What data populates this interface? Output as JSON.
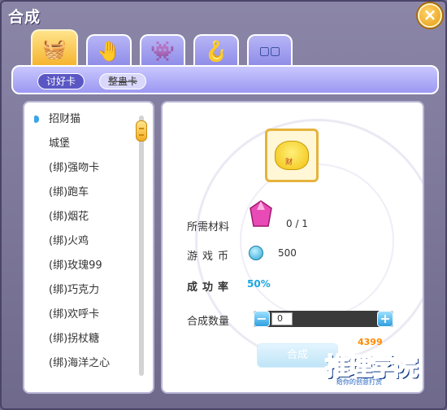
{
  "window": {
    "title": "合成",
    "close_label": "×"
  },
  "tabs": [
    {
      "name": "basket",
      "glyph": "🧺",
      "active": true
    },
    {
      "name": "hand",
      "glyph": "🤚",
      "active": false
    },
    {
      "name": "pet",
      "glyph": "👾",
      "active": false
    },
    {
      "name": "hanger",
      "glyph": "🪝",
      "active": false
    },
    {
      "name": "grid",
      "glyph": "▢▢",
      "active": false
    }
  ],
  "subtabs": {
    "active_label": "讨好卡",
    "inactive_label": "整蛊卡"
  },
  "list": {
    "items": [
      "招财猫",
      "城堡",
      "(绑)强吻卡",
      "(绑)跑车",
      "(绑)烟花",
      "(绑)火鸡",
      "(绑)玫瑰99",
      "(绑)巧克力",
      "(绑)欢呼卡",
      "(绑)拐杖糖",
      "(绑)海洋之心"
    ],
    "selected_index": 0
  },
  "detail": {
    "item_badge": "财",
    "materials_label": "所需材料",
    "materials_value": "0 / 1",
    "coin_label": "游戏币",
    "coin_value": "500",
    "rate_label": "成功率",
    "rate_value": "50%",
    "qty_label": "合成数量",
    "qty_value": "0",
    "minus_label": "−",
    "plus_label": "+",
    "compose_label": "合成"
  },
  "logo": {
    "main": "推理学院",
    "number": "4399",
    "sub": "给你的创意打赏"
  },
  "colors": {
    "accent": "#5a57c4",
    "rate": "#1ca6e0",
    "frame": "#6f6a8c"
  }
}
